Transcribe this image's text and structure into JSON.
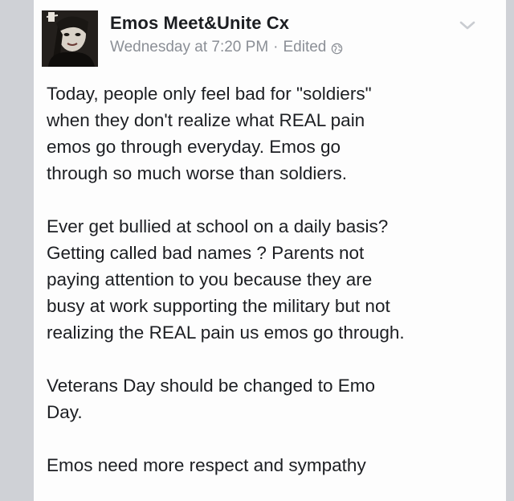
{
  "post": {
    "author": "Emos Meet&Unite Cx",
    "timestamp": "Wednesday at 7:20 PM",
    "separator": "·",
    "edited_label": "Edited",
    "privacy_icon": "globe-icon",
    "options_icon": "chevron-down-icon",
    "paragraphs": [
      "Today, people only feel bad for \"soldiers\"\nwhen they  don't realize what REAL pain\nemos go through everyday. Emos go\nthrough so much worse than soldiers.",
      "Ever get bullied at school on a daily basis?\nGetting called bad names ? Parents not\npaying attention to you because they are\nbusy at work supporting the military but not\nrealizing the REAL pain us emos go through.",
      "Veterans Day should be changed to Emo\nDay.",
      "Emos need more respect and sympathy"
    ]
  },
  "colors": {
    "card_background": "#fdfdfd",
    "text": "#1c1e22",
    "meta_text": "#8b8f96",
    "frame": "#d9dadd"
  }
}
